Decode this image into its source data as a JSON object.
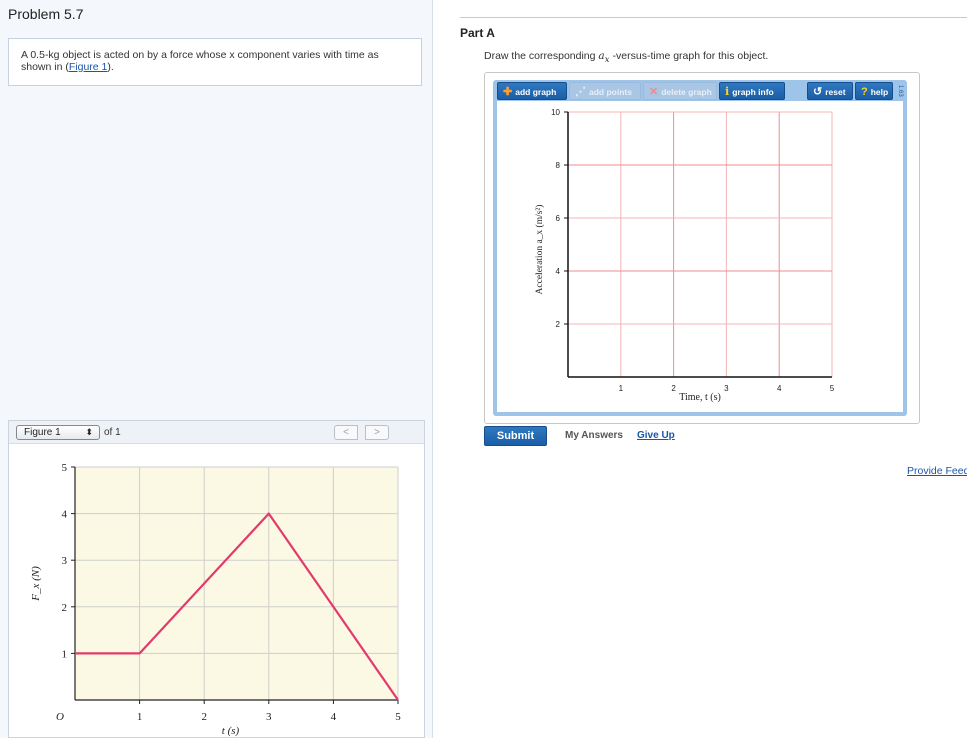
{
  "problem": {
    "title": "Problem 5.7",
    "text_before": "A 0.5-kg object is acted on by a force whose x component varies with time as shown in (",
    "figure_link": "Figure 1",
    "text_after": ")."
  },
  "figure_viewer": {
    "selected": "Figure 1",
    "of_label": "of 1",
    "prev_label": "<",
    "next_label": ">"
  },
  "part_a": {
    "title": "Part A",
    "instruction": "Draw the corresponding a_x -versus-time graph for this object."
  },
  "toolbar": {
    "add_graph": "add graph",
    "add_points": "add points",
    "delete_graph": "delete graph",
    "graph_info": "graph info",
    "reset": "reset",
    "help": "help",
    "version": "1.63"
  },
  "actions": {
    "submit": "Submit",
    "my_answers": "My Answers",
    "give_up": "Give Up",
    "provide_feedback": "Provide Feedback"
  },
  "colors": {
    "accent": "#1a5ea6",
    "plot_bg": "#fbf9e3",
    "force_line": "#e23a6b",
    "graph_grid": "#f4b5b5"
  },
  "chart_data": [
    {
      "type": "line",
      "xlabel": "t (s)",
      "ylabel": "F_x (N)",
      "x_ticks": [
        "O",
        "1",
        "2",
        "3",
        "4",
        "5"
      ],
      "y_ticks": [
        "1",
        "2",
        "3",
        "4",
        "5"
      ],
      "xlim": [
        0,
        5
      ],
      "ylim": [
        0,
        5
      ],
      "grid": true,
      "series": [
        {
          "x": [
            0,
            1,
            3,
            5
          ],
          "y": [
            1,
            1,
            4,
            0
          ]
        }
      ]
    },
    {
      "type": "line",
      "xlabel": "Time, t (s)",
      "ylabel": "Acceleration a_x (m/s²)",
      "x_ticks": [
        "1",
        "2",
        "3",
        "4",
        "5"
      ],
      "y_ticks": [
        "2",
        "4",
        "6",
        "8",
        "10"
      ],
      "xlim": [
        0,
        5
      ],
      "ylim": [
        0,
        10
      ],
      "grid": true,
      "series": []
    }
  ]
}
